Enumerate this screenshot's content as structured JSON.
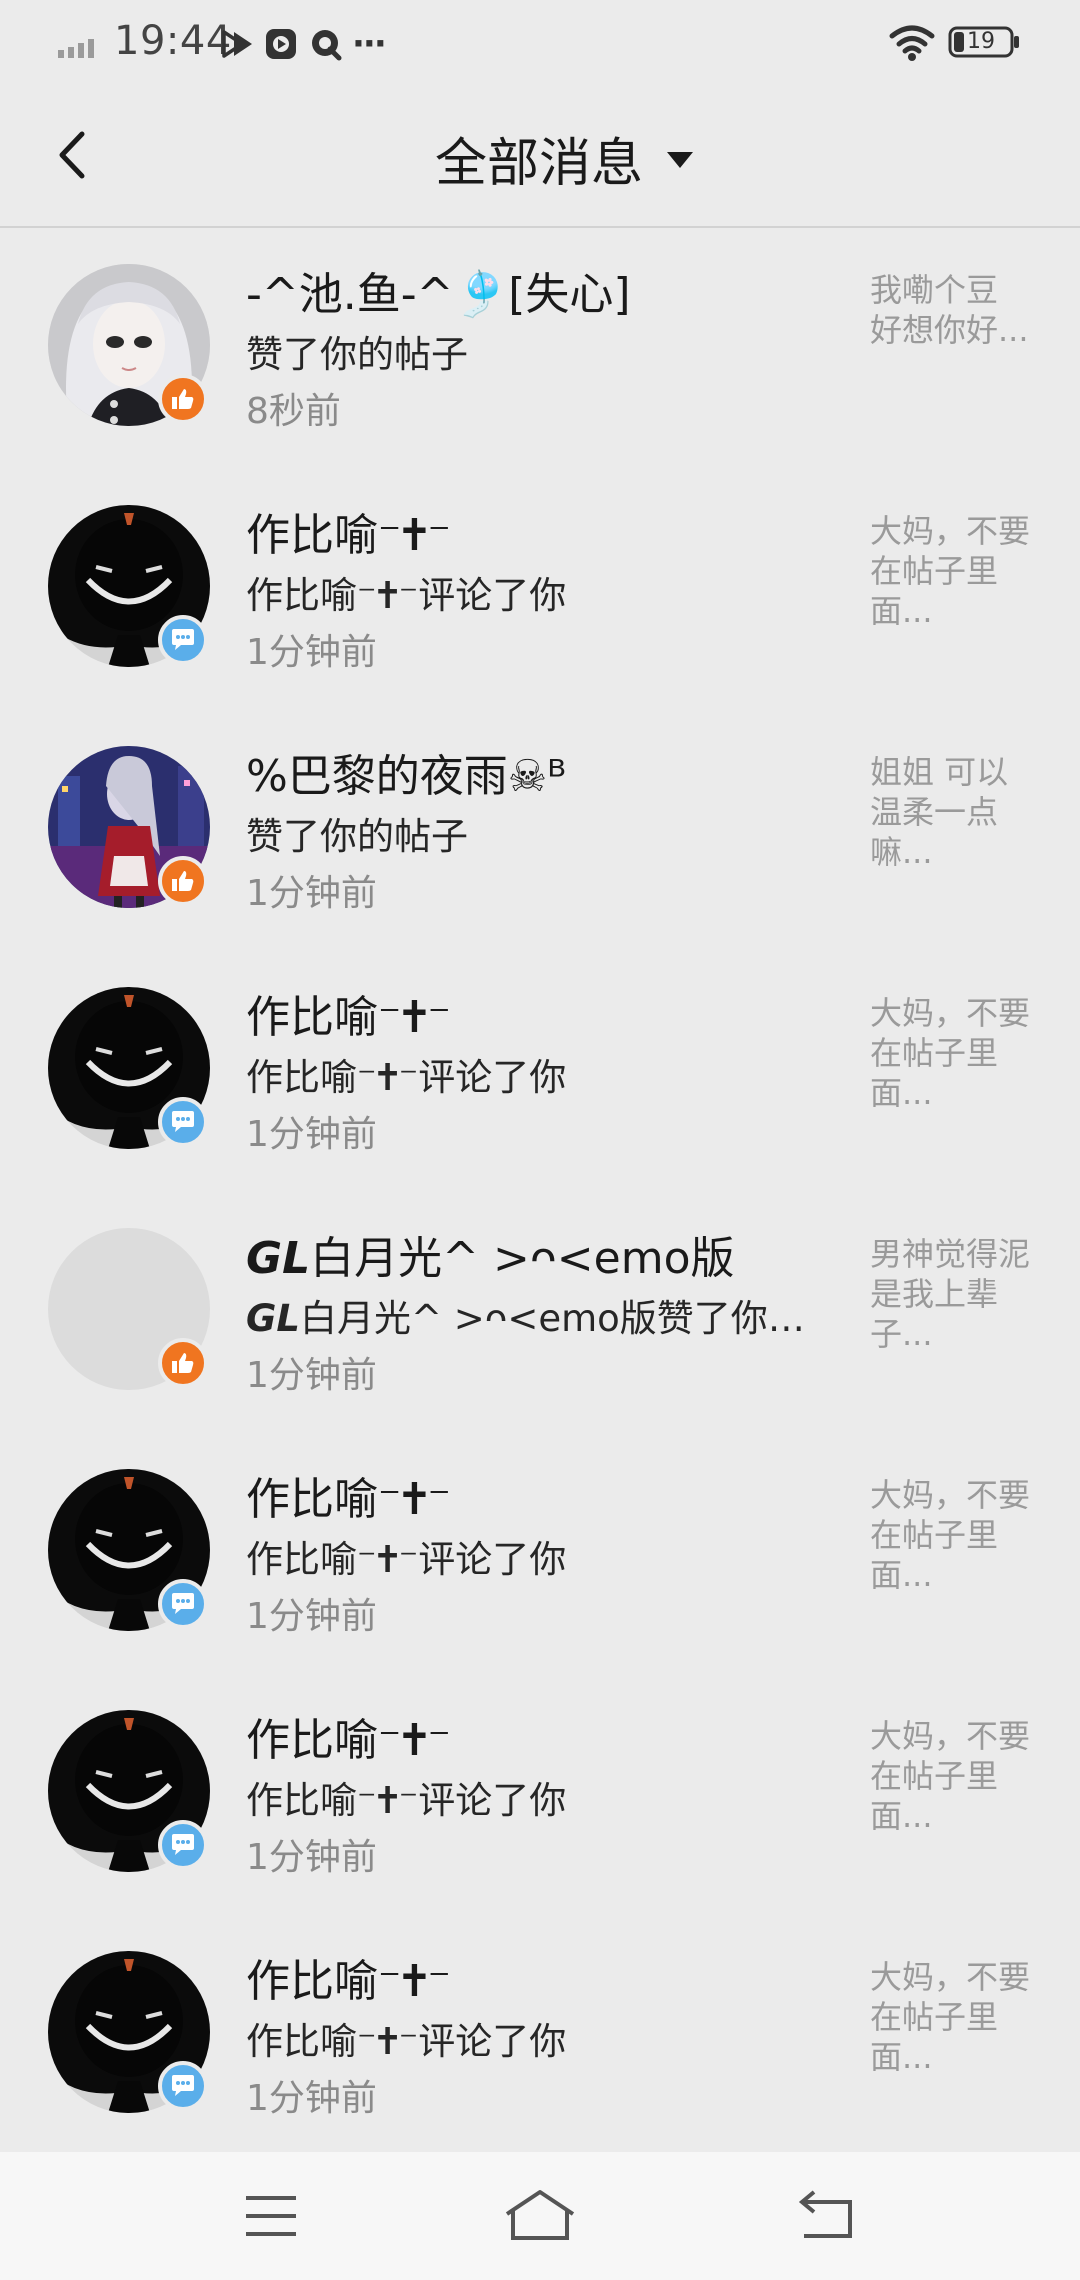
{
  "status_bar": {
    "time": "19:44",
    "battery": "19",
    "more": "···"
  },
  "header": {
    "title": "全部消息"
  },
  "messages": [
    {
      "name": "-^池.鱼-^🎐[失心]",
      "action": "赞了你的帖子",
      "time": "8秒前",
      "preview": "我嘞个豆 好想你好...",
      "type": "like",
      "avatar": "white-hair-girl"
    },
    {
      "name": "作比喻⁻🕇⁻",
      "action": "作比喻⁻🕇⁻评论了你",
      "time": "1分钟前",
      "preview": "大妈，不要在帖子里面...",
      "type": "comment",
      "avatar": "dark-smile-figure"
    },
    {
      "name": "%巴黎的夜雨☠ᴮ",
      "action": "赞了你的帖子",
      "time": "1分钟前",
      "preview": "姐姐 可以温柔一点嘛...",
      "type": "like",
      "avatar": "anime-girl-night"
    },
    {
      "name": "作比喻⁻🕇⁻",
      "action": "作比喻⁻🕇⁻评论了你",
      "time": "1分钟前",
      "preview": "大妈，不要在帖子里面...",
      "type": "comment",
      "avatar": "dark-smile-figure"
    },
    {
      "name_prefix": "GL",
      "name": "白月光^ >ᴖ<emo版",
      "action_prefix": "GL",
      "action": "白月光^ >ᴖ<emo版赞了你的帖子",
      "time": "1分钟前",
      "preview": "男神觉得泥是我上辈子...",
      "type": "like",
      "avatar": "blank"
    },
    {
      "name": "作比喻⁻🕇⁻",
      "action": "作比喻⁻🕇⁻评论了你",
      "time": "1分钟前",
      "preview": "大妈，不要在帖子里面...",
      "type": "comment",
      "avatar": "dark-smile-figure"
    },
    {
      "name": "作比喻⁻🕇⁻",
      "action": "作比喻⁻🕇⁻评论了你",
      "time": "1分钟前",
      "preview": "大妈，不要在帖子里面...",
      "type": "comment",
      "avatar": "dark-smile-figure"
    },
    {
      "name": "作比喻⁻🕇⁻",
      "action": "作比喻⁻🕇⁻评论了你",
      "time": "1分钟前",
      "preview": "大妈，不要在帖子里面...",
      "type": "comment",
      "avatar": "dark-smile-figure"
    }
  ],
  "colors": {
    "background": "#ebebeb",
    "like_badge": "#f07520",
    "comment_badge": "#5aaeea",
    "secondary_text": "#8a8a8a",
    "preview_text": "#9a9a9a"
  },
  "nav": {
    "icons": [
      "menu-icon",
      "home-icon",
      "back-icon"
    ]
  }
}
